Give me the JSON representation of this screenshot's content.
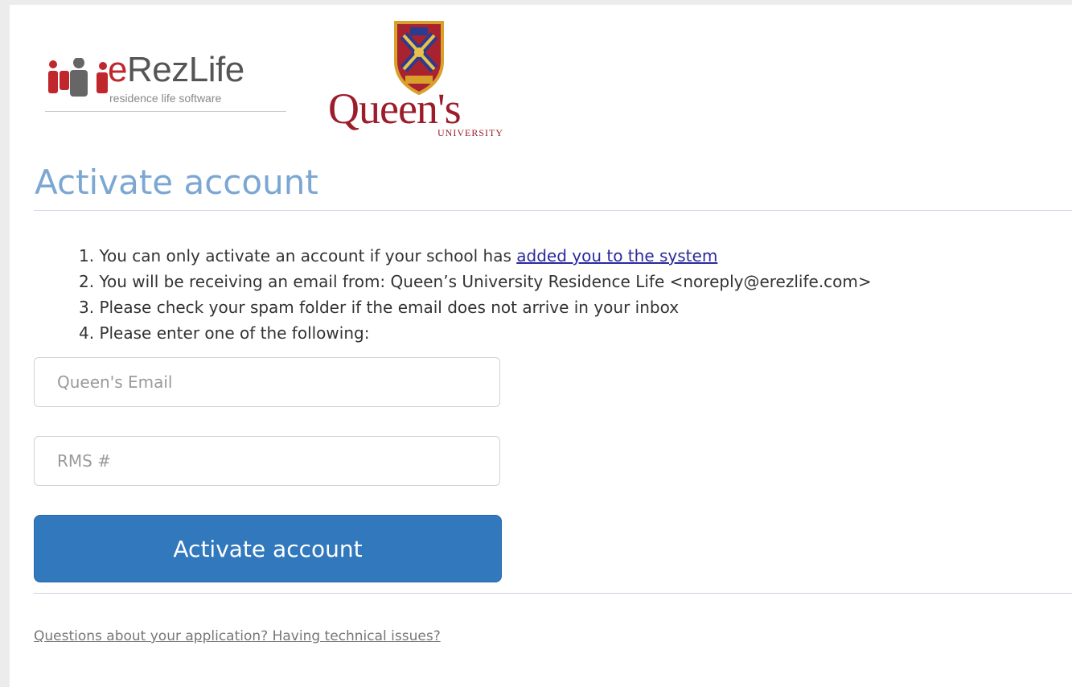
{
  "logos": {
    "erez_name_e": "e",
    "erez_name_rest": "RezLife",
    "erez_tagline": "residence life software",
    "queens_name": "Queen's",
    "queens_sub": "UNIVERSITY"
  },
  "page_title": "Activate account",
  "steps": [
    {
      "text": "1. You can only activate an account if your school has ",
      "link": "added you to the system"
    },
    {
      "text": "2. You will be receiving an email from: Queen’s University Residence Life <noreply@erezlife.com>"
    },
    {
      "text": "3. Please check your spam folder if the email does not arrive in your inbox"
    },
    {
      "text": "4. Please enter one of the following:"
    }
  ],
  "fields": {
    "email_placeholder": "Queen's Email",
    "email_value": "",
    "rms_placeholder": "RMS #",
    "rms_value": ""
  },
  "submit_label": "Activate account",
  "help_link": "Questions about your application? Having technical issues?",
  "colors": {
    "title": "#7ba7d2",
    "button": "#3278bd",
    "brand_red": "#c0272d",
    "queens_red": "#9c1c2b"
  }
}
